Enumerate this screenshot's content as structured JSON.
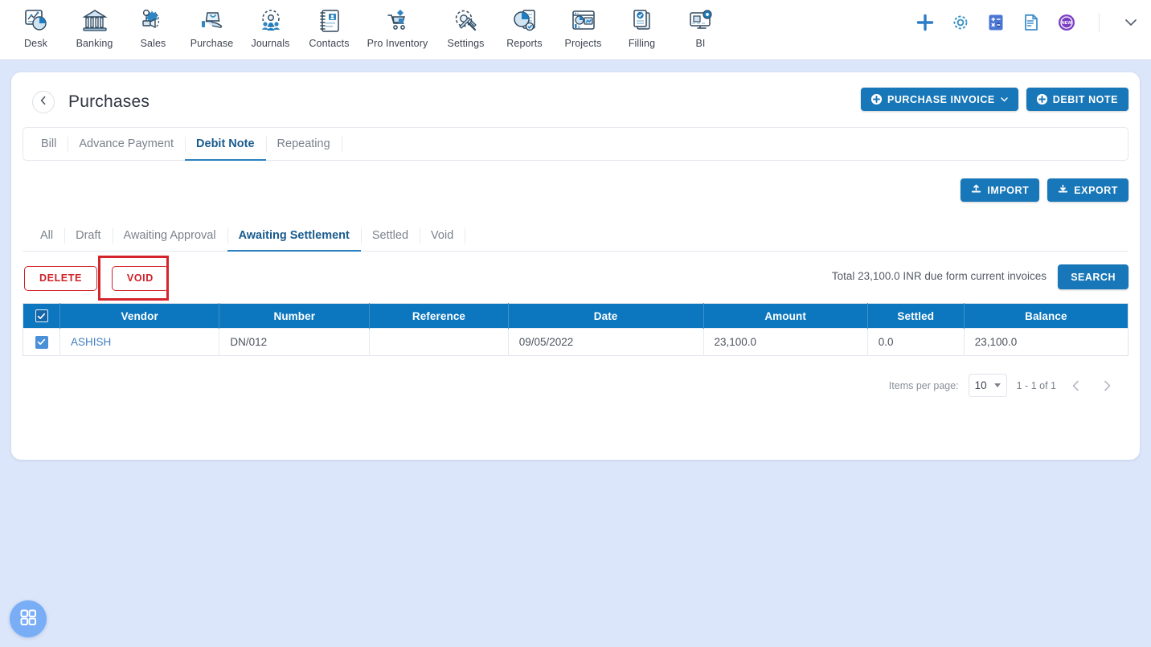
{
  "topnav": {
    "items": [
      {
        "label": "Desk",
        "icon": "desk-dashboard-icon"
      },
      {
        "label": "Banking",
        "icon": "bank-building-icon"
      },
      {
        "label": "Sales",
        "icon": "sales-megaphone-icon"
      },
      {
        "label": "Purchase",
        "icon": "purchase-bag-hand-icon"
      },
      {
        "label": "Journals",
        "icon": "journals-gear-people-icon"
      },
      {
        "label": "Contacts",
        "icon": "contacts-book-icon"
      },
      {
        "label": "Pro Inventory",
        "icon": "inventory-cart-icon"
      },
      {
        "label": "Settings",
        "icon": "settings-gear-wrench-icon"
      },
      {
        "label": "Reports",
        "icon": "reports-piechart-icon"
      },
      {
        "label": "Projects",
        "icon": "projects-window-chart-icon"
      },
      {
        "label": "Filling",
        "icon": "filling-documents-check-icon"
      },
      {
        "label": "BI",
        "icon": "bi-monitor-gear-icon"
      }
    ],
    "right_icons": [
      {
        "name": "add-plus-icon",
        "color": "#2b7cc7"
      },
      {
        "name": "settings-gear-icon",
        "color": "#3a93c4"
      },
      {
        "name": "calculator-icon",
        "color": "#4a76d4"
      },
      {
        "name": "notes-document-icon",
        "color": "#3f8ecb"
      },
      {
        "name": "new-badge-icon",
        "color": "#7b3fc4",
        "text": "NEW"
      },
      {
        "name": "chevron-down-icon",
        "color": "#5a6575"
      }
    ]
  },
  "page": {
    "title": "Purchases",
    "back_icon": "chevron-left-icon"
  },
  "header_actions": {
    "purchase_invoice_label": "PURCHASE INVOICE",
    "debit_note_label": "DEBIT NOTE"
  },
  "doc_tabs": {
    "items": [
      {
        "label": "Bill",
        "active": false
      },
      {
        "label": "Advance Payment",
        "active": false
      },
      {
        "label": "Debit Note",
        "active": true
      },
      {
        "label": "Repeating",
        "active": false
      }
    ]
  },
  "io_buttons": {
    "import_label": "IMPORT",
    "export_label": "EXPORT"
  },
  "status_tabs": {
    "items": [
      {
        "label": "All",
        "active": false
      },
      {
        "label": "Draft",
        "active": false
      },
      {
        "label": "Awaiting Approval",
        "active": false
      },
      {
        "label": "Awaiting Settlement",
        "active": true
      },
      {
        "label": "Settled",
        "active": false
      },
      {
        "label": "Void",
        "active": false
      }
    ]
  },
  "actions": {
    "delete_label": "DELETE",
    "void_label": "VOID",
    "total_text": "Total 23,100.0 INR due form current invoices",
    "search_label": "SEARCH"
  },
  "table": {
    "columns": [
      "Vendor",
      "Number",
      "Reference",
      "Date",
      "Amount",
      "Settled",
      "Balance"
    ],
    "header_checkbox_checked": true,
    "rows": [
      {
        "checked": true,
        "vendor": "ASHISH",
        "number": "DN/012",
        "reference": "",
        "date": "09/05/2022",
        "amount": "23,100.0",
        "settled": "0.0",
        "balance": "23,100.0"
      }
    ]
  },
  "pagination": {
    "items_per_page_label": "Items per page:",
    "items_per_page_value": "10",
    "range_text": "1 - 1 of 1",
    "prev_icon": "chevron-left-icon",
    "next_icon": "chevron-right-icon"
  },
  "fab": {
    "icon": "grid-apps-icon"
  },
  "colors": {
    "page_bg": "#dce6fa",
    "primary_blue": "#1877b8",
    "table_header_blue": "#0c77bf",
    "danger_red": "#cf2027",
    "annotation_red": "#d5242b",
    "link_blue": "#3f7fc0",
    "active_tab_blue": "#1a5b8e"
  }
}
